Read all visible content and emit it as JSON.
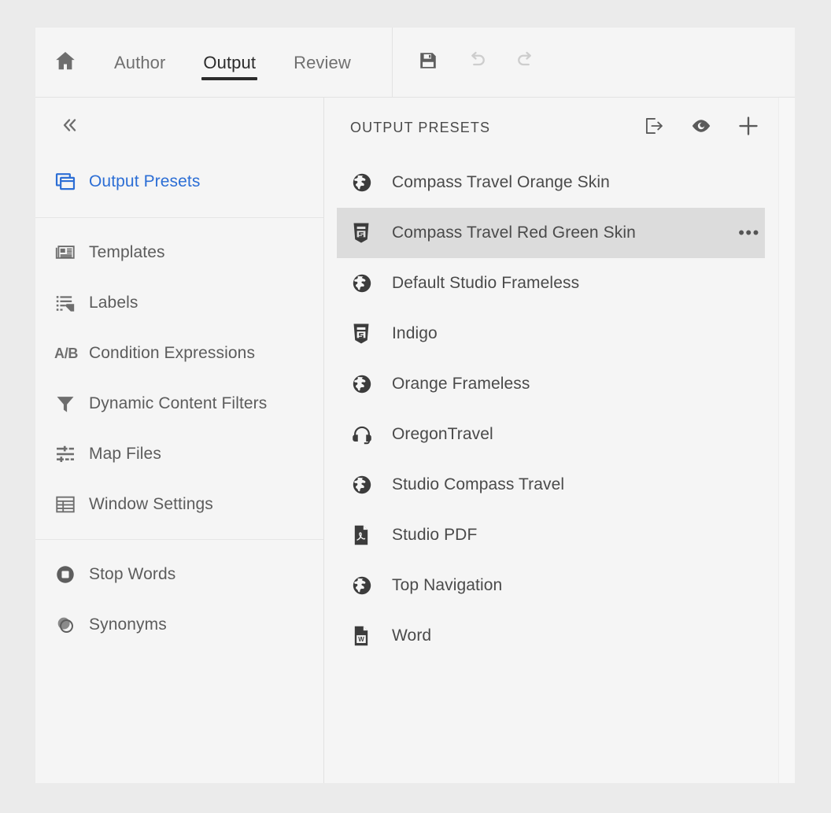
{
  "toolbar": {
    "home_icon": "home-icon",
    "tabs": [
      {
        "label": "Author",
        "active": false
      },
      {
        "label": "Output",
        "active": true
      },
      {
        "label": "Review",
        "active": false
      }
    ],
    "actions": [
      {
        "name": "save-button",
        "icon": "floppy-disk-icon",
        "enabled": true
      },
      {
        "name": "undo-button",
        "icon": "undo-arrow-icon",
        "enabled": false
      },
      {
        "name": "redo-button",
        "icon": "redo-arrow-icon",
        "enabled": false
      }
    ]
  },
  "sidebar": {
    "collapse_icon": "double-chevron-left-icon",
    "groups": [
      {
        "items": [
          {
            "label": "Output Presets",
            "icon": "windows-stack-icon",
            "active": true
          }
        ]
      },
      {
        "items": [
          {
            "label": "Templates",
            "icon": "newspaper-icon",
            "active": false
          },
          {
            "label": "Labels",
            "icon": "list-tag-icon",
            "active": false
          },
          {
            "label": "Condition Expressions",
            "icon": "ab-text-icon",
            "glyph": "A/B",
            "active": false
          },
          {
            "label": "Dynamic Content Filters",
            "icon": "funnel-icon",
            "active": false
          },
          {
            "label": "Map Files",
            "icon": "sliders-icon",
            "active": false
          },
          {
            "label": "Window Settings",
            "icon": "table-grid-icon",
            "active": false
          }
        ]
      },
      {
        "items": [
          {
            "label": "Stop Words",
            "icon": "stop-circle-icon",
            "active": false
          },
          {
            "label": "Synonyms",
            "icon": "overlapping-circles-icon",
            "active": false
          }
        ]
      }
    ]
  },
  "main": {
    "title": "OUTPUT PRESETS",
    "header_actions": [
      {
        "name": "publish-button",
        "icon": "export-arrow-icon"
      },
      {
        "name": "preview-button",
        "icon": "eye-icon"
      },
      {
        "name": "add-preset-button",
        "icon": "plus-icon"
      }
    ],
    "presets": [
      {
        "label": "Compass Travel Orange Skin",
        "icon": "globe-icon",
        "selected": false
      },
      {
        "label": "Compass Travel Red Green Skin",
        "icon": "html5-icon",
        "selected": true,
        "more": "•••"
      },
      {
        "label": "Default Studio Frameless",
        "icon": "globe-icon",
        "selected": false
      },
      {
        "label": "Indigo",
        "icon": "html5-icon",
        "selected": false
      },
      {
        "label": "Orange Frameless",
        "icon": "globe-icon",
        "selected": false
      },
      {
        "label": "OregonTravel",
        "icon": "headset-icon",
        "selected": false
      },
      {
        "label": "Studio Compass Travel",
        "icon": "globe-icon",
        "selected": false
      },
      {
        "label": "Studio PDF",
        "icon": "pdf-icon",
        "selected": false
      },
      {
        "label": "Top Navigation",
        "icon": "globe-icon",
        "selected": false
      },
      {
        "label": "Word",
        "icon": "word-icon",
        "selected": false
      }
    ]
  },
  "colors": {
    "accent_blue": "#2c6ed5",
    "page_background": "#ebebeb",
    "panel_background": "#f5f5f5",
    "selected_row": "#dcdcdc",
    "text_primary": "#4a4a4a",
    "text_muted": "#707070"
  }
}
